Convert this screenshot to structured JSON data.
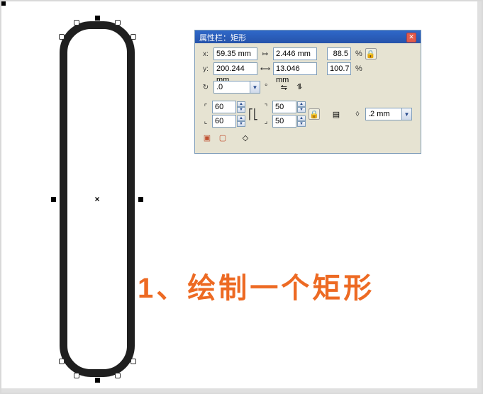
{
  "panel": {
    "title": "属性栏：矩形",
    "position": {
      "x_label": "x:",
      "x_value": "59.35 mm",
      "y_label": "y:",
      "y_value": "200.244 mm"
    },
    "size": {
      "w_value": "2.446 mm",
      "h_value": "13.046 mm"
    },
    "scale": {
      "sx": "88.5",
      "sy": "100.7",
      "unit": "%"
    },
    "rotation": {
      "value": ".0",
      "unit": "°"
    },
    "corner_radius": {
      "tl": "60",
      "bl": "60",
      "tr": "50",
      "br": "50"
    },
    "outline_width": ".2 mm"
  },
  "caption": "1、绘制一个矩形",
  "shape": {
    "center_marker": "×"
  }
}
